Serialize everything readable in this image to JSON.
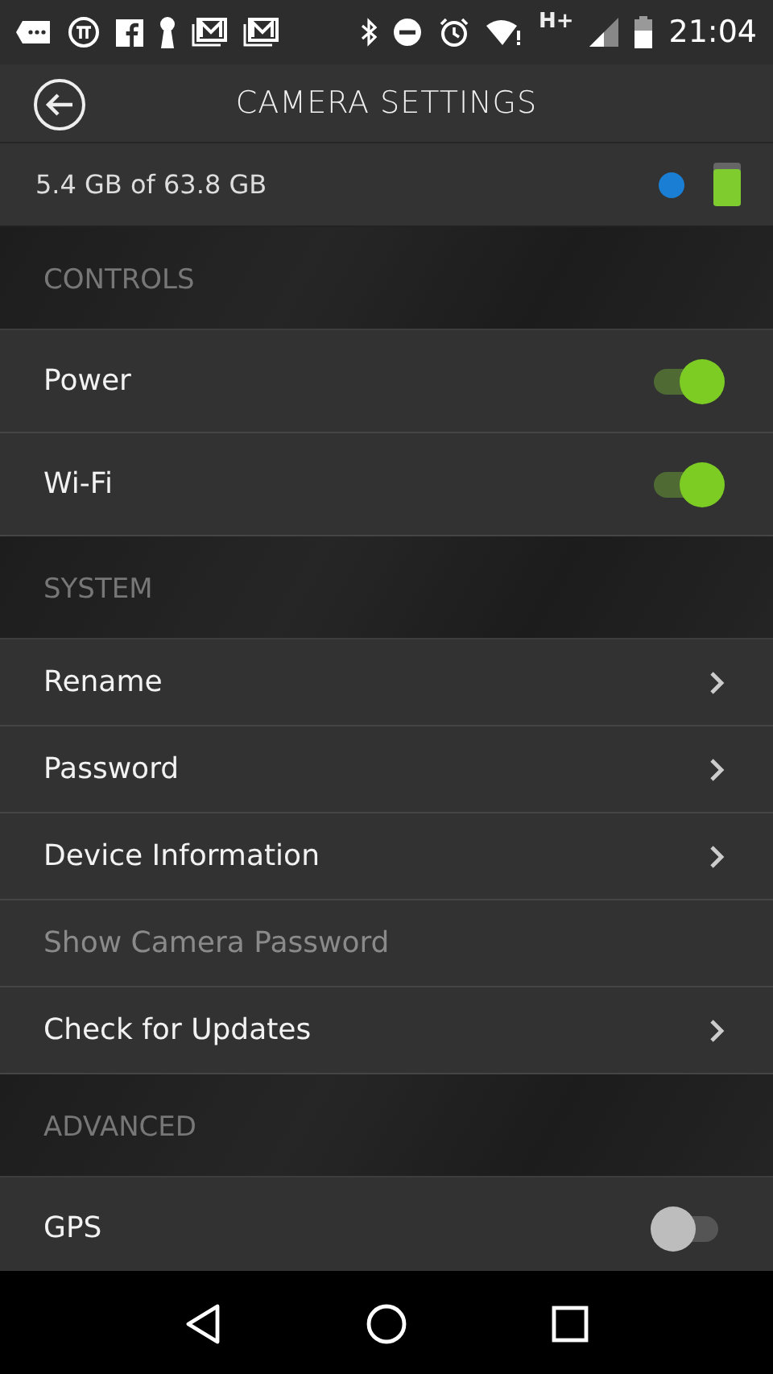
{
  "status_bar": {
    "time": "21:04",
    "network": "H+"
  },
  "header": {
    "title": "CAMERA SETTINGS"
  },
  "storage": {
    "text": "5.4 GB of 63.8 GB",
    "status_dot": {
      "color": "#1a7fd4"
    },
    "battery": {
      "level": 0.85
    }
  },
  "sections": [
    {
      "title": "CONTROLS",
      "items": [
        {
          "label": "Power",
          "kind": "toggle",
          "on": true
        },
        {
          "label": "Wi-Fi",
          "kind": "toggle",
          "on": true
        }
      ]
    },
    {
      "title": "SYSTEM",
      "items": [
        {
          "label": "Rename",
          "kind": "link",
          "disabled": false
        },
        {
          "label": "Password",
          "kind": "link",
          "disabled": false
        },
        {
          "label": "Device Information",
          "kind": "link",
          "disabled": false
        },
        {
          "label": "Show Camera Password",
          "kind": "plain",
          "disabled": true
        },
        {
          "label": "Check for Updates",
          "kind": "link",
          "disabled": false
        }
      ]
    },
    {
      "title": "ADVANCED",
      "items": [
        {
          "label": "GPS",
          "kind": "toggle",
          "on": false
        }
      ]
    }
  ]
}
